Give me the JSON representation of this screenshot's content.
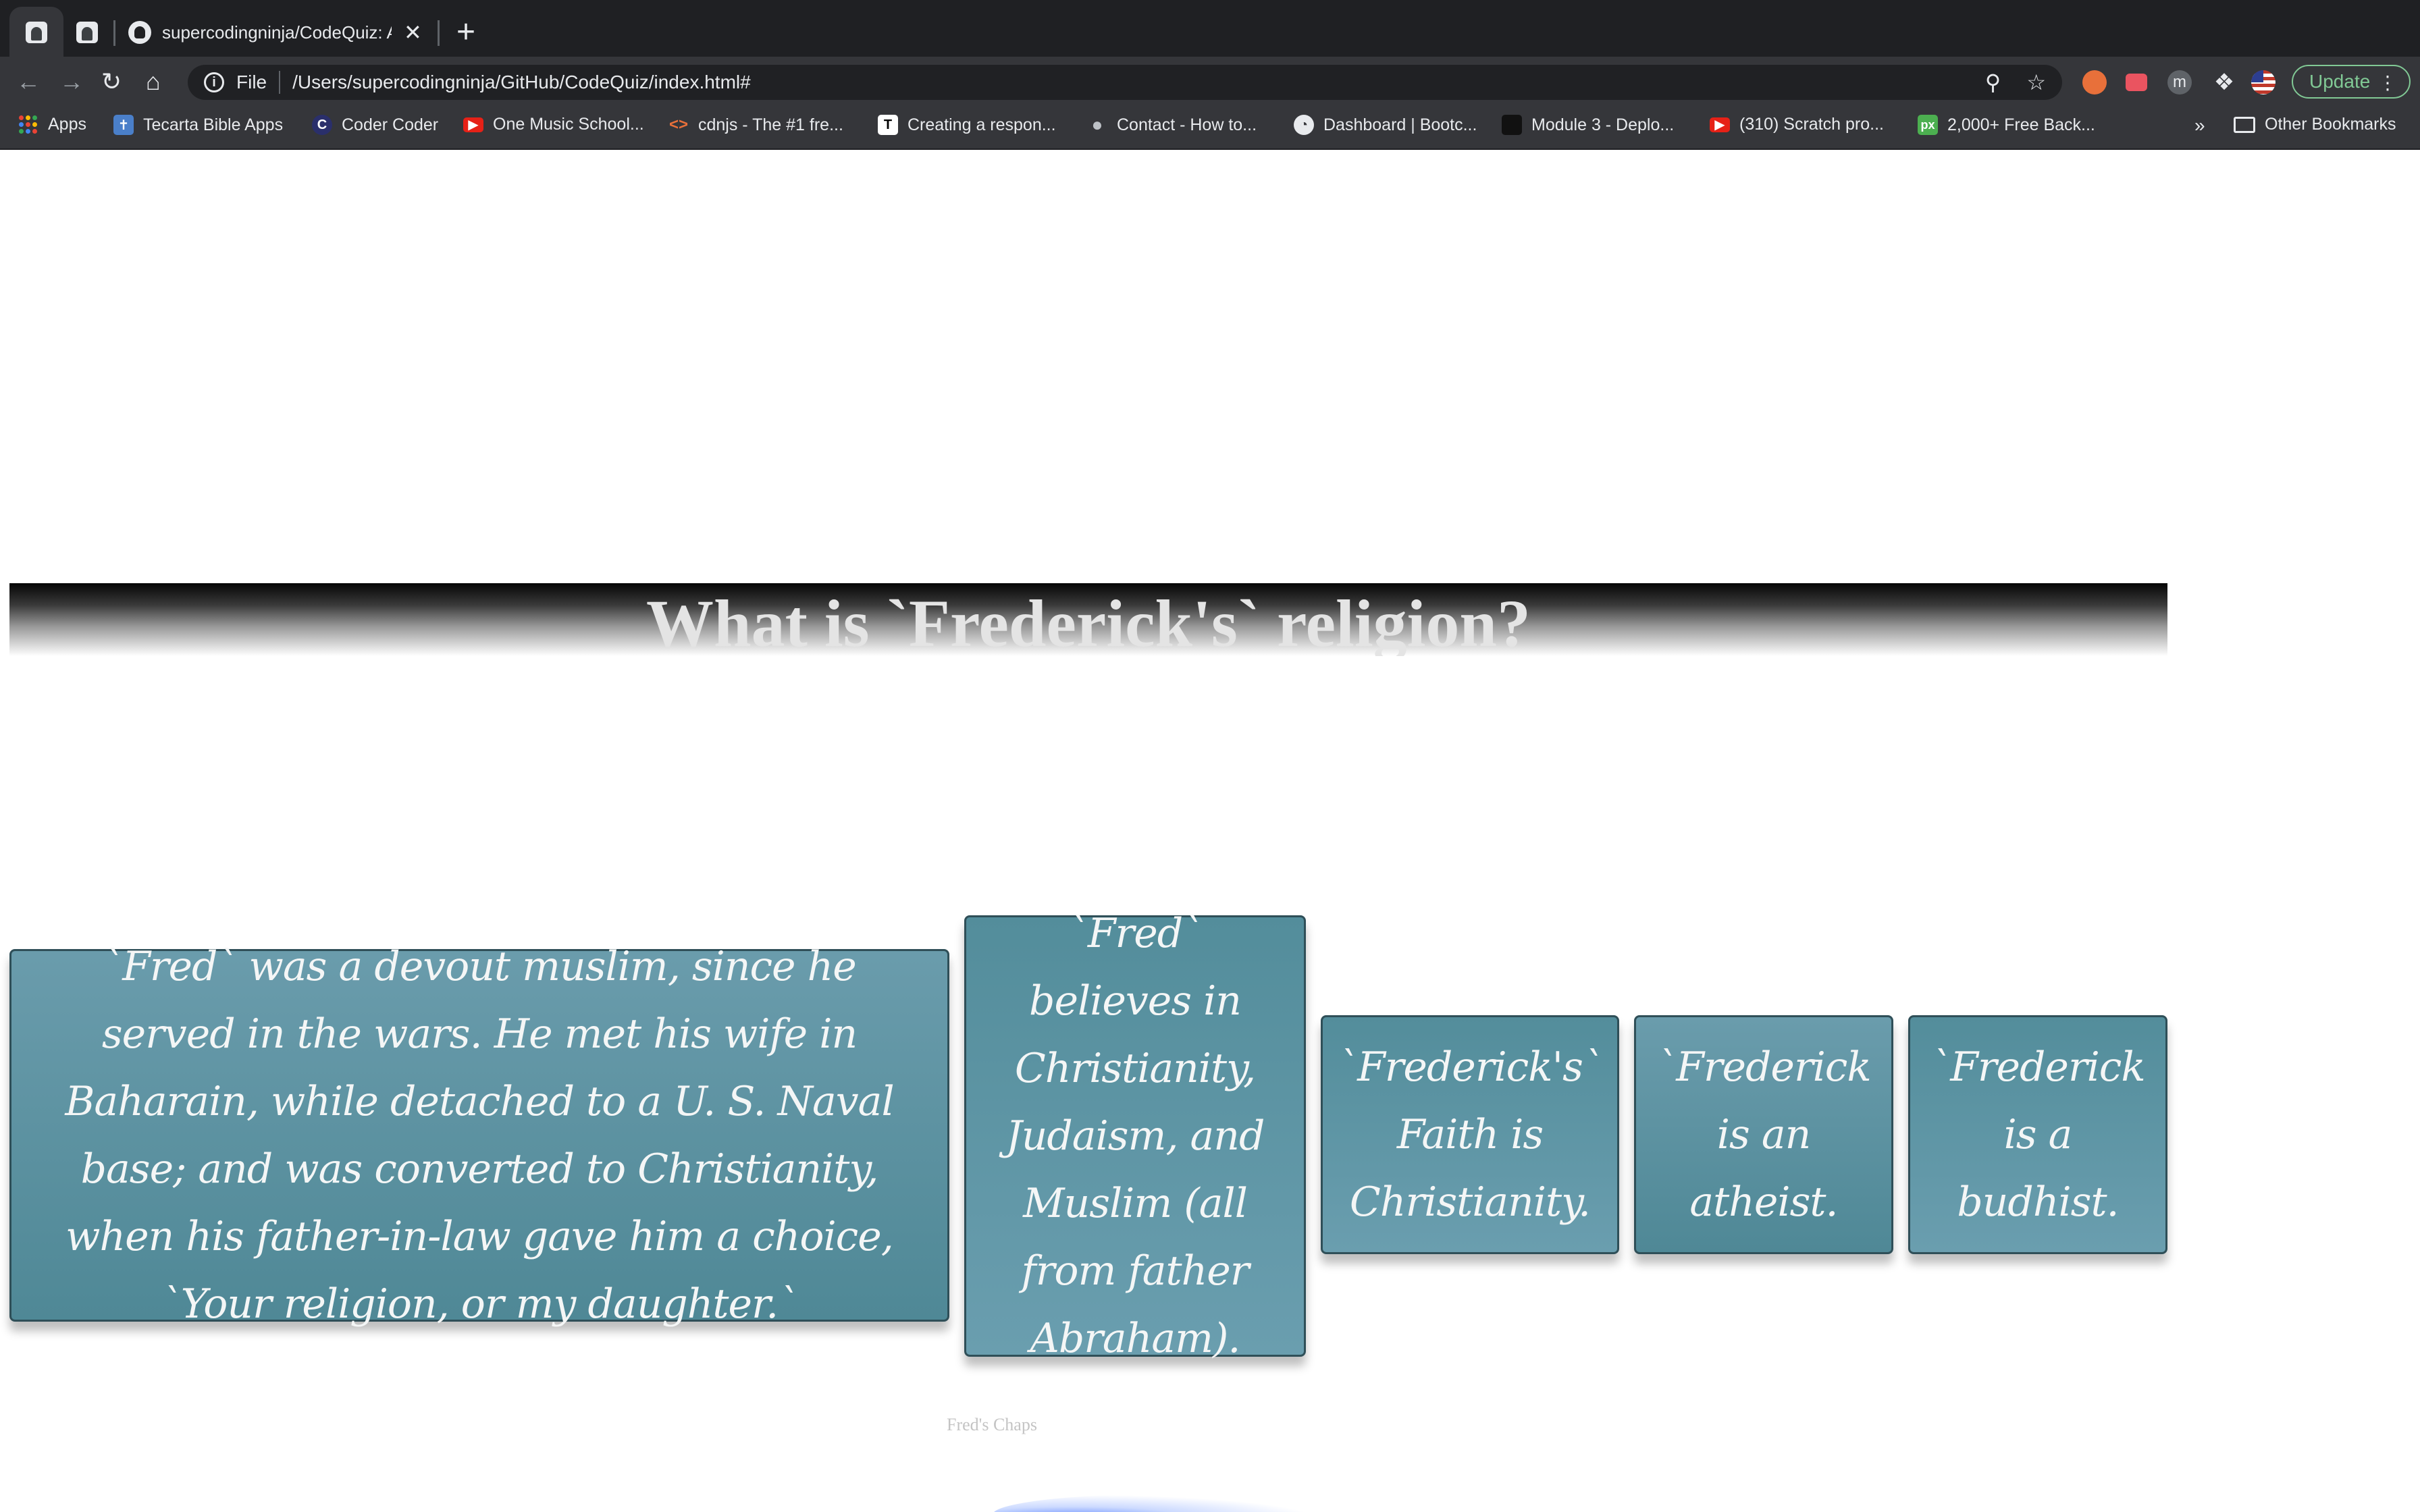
{
  "browser": {
    "active_tab_title": "supercodingninja/CodeQuiz: A",
    "new_tab_symbol": "+",
    "close_symbol": "✕",
    "file_label": "File",
    "url": "/Users/supercodingninja/GitHub/CodeQuiz/index.html#",
    "update_label": "Update",
    "bookmarks": [
      {
        "label": "Apps",
        "icon": "apps-grid-icon"
      },
      {
        "label": "Tecarta Bible Apps",
        "icon": "tecarta-icon"
      },
      {
        "label": "Coder Coder",
        "icon": "coder-coder-icon"
      },
      {
        "label": "One Music School...",
        "icon": "youtube-icon"
      },
      {
        "label": "cdnjs - The #1 fre...",
        "icon": "code-brackets-icon"
      },
      {
        "label": "Creating a respon...",
        "icon": "t-logo-icon"
      },
      {
        "label": "Contact - How to...",
        "icon": "apple-icon"
      },
      {
        "label": "Dashboard | Bootc...",
        "icon": "globe-icon"
      },
      {
        "label": "Module 3 - Deplo...",
        "icon": "book-icon"
      },
      {
        "label": "(310) Scratch pro...",
        "icon": "youtube-icon"
      },
      {
        "label": "2,000+ Free Back...",
        "icon": "px-icon"
      }
    ],
    "overflow_symbol": "»",
    "other_bookmarks_label": "Other Bookmarks"
  },
  "quiz": {
    "question": "What is `Frederick's` religion?",
    "answers": [
      "`Fred` was a devout muslim, since he served in the wars. He met his wife in Baharain, while detached to a U. S. Naval base; and was converted to Christianity, when his father-in-law gave him a choice, `Your religion, or my daughter.`",
      "`Fred` believes in Christianity, Judaism, and Muslim (all from father Abraham).",
      "`Frederick's` Faith is Christianity.",
      "`Frederick is an atheist.",
      "`Frederick is a budhist."
    ],
    "footer": "Fred's Chaps"
  },
  "colors": {
    "answer_fill": "#5b93a3",
    "answer_border": "#2f4f58",
    "update_green": "#81c995"
  }
}
